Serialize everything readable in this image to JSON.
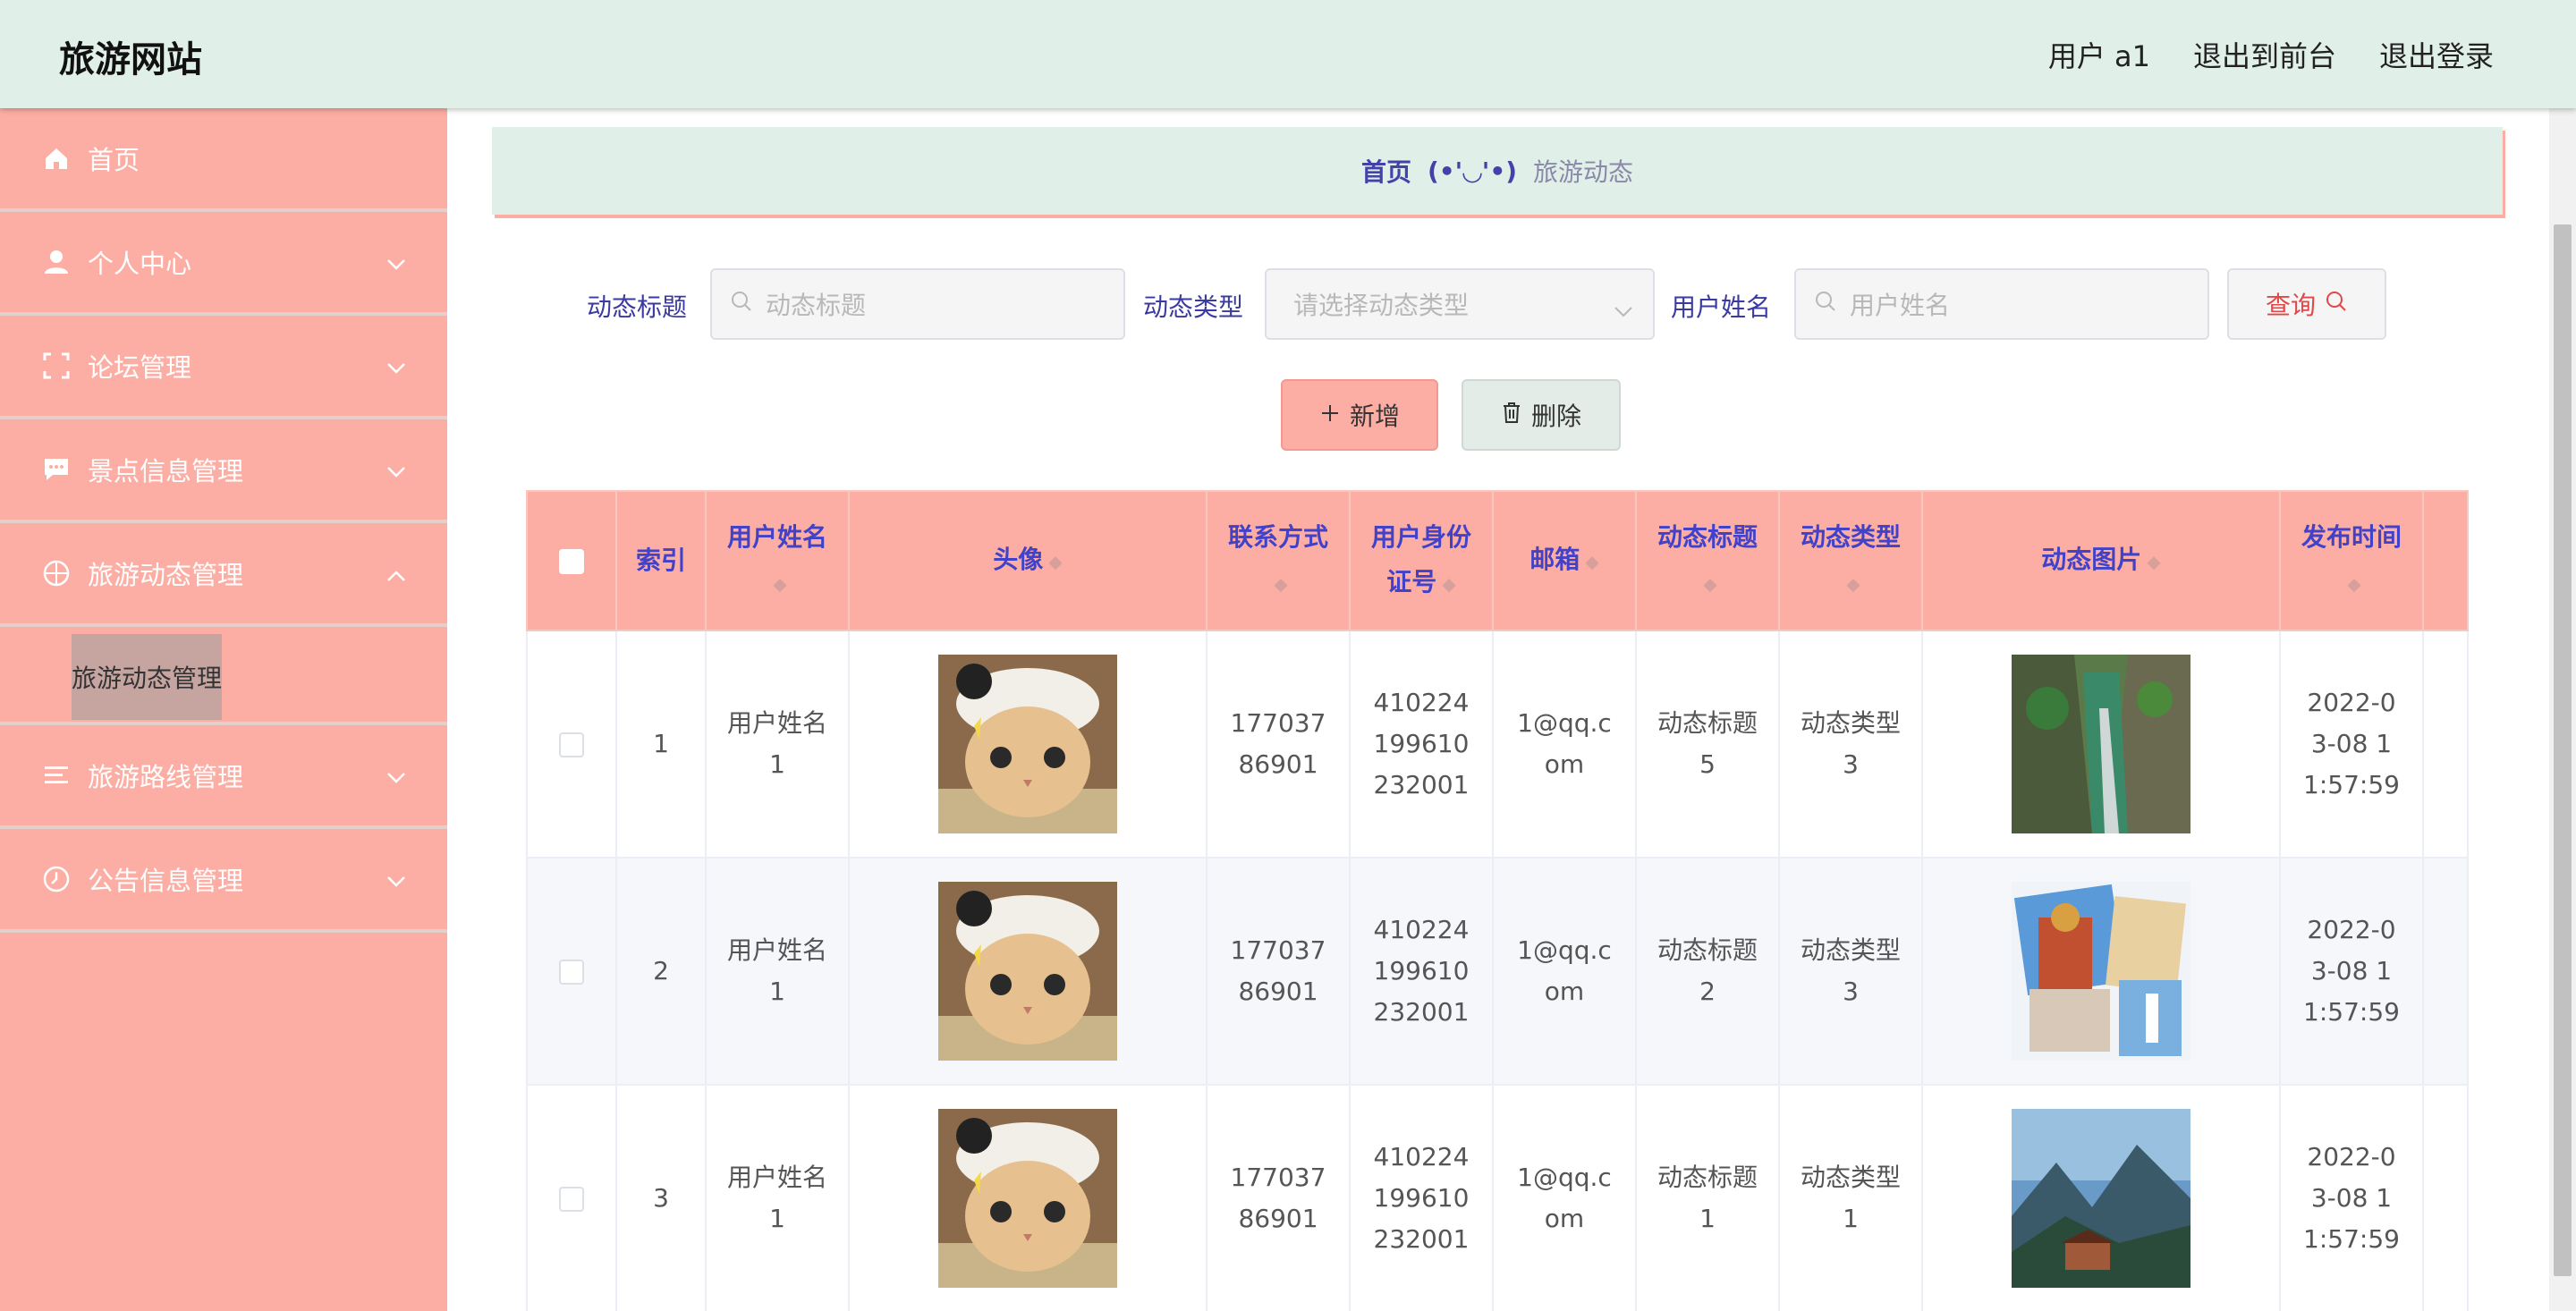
{
  "header": {
    "title": "旅游网站",
    "user": "用户 a1",
    "exit_front": "退出到前台",
    "logout": "退出登录"
  },
  "sidebar": {
    "items": [
      {
        "label": "首页",
        "icon": "home-icon"
      },
      {
        "label": "个人中心",
        "icon": "user-icon"
      },
      {
        "label": "论坛管理",
        "icon": "frame-icon"
      },
      {
        "label": "景点信息管理",
        "icon": "message-icon"
      },
      {
        "label": "旅游动态管理",
        "icon": "compass-icon"
      },
      {
        "label": "旅游路线管理",
        "icon": "list-icon"
      },
      {
        "label": "公告信息管理",
        "icon": "clock-icon"
      }
    ],
    "active_sub": "旅游动态管理"
  },
  "breadcrumb": {
    "home": "首页",
    "emoji": "(•'◡'•)",
    "current": "旅游动态"
  },
  "search": {
    "title_label": "动态标题",
    "title_placeholder": "动态标题",
    "type_label": "动态类型",
    "type_placeholder": "请选择动态类型",
    "name_label": "用户姓名",
    "name_placeholder": "用户姓名",
    "query_button": "查询"
  },
  "actions": {
    "add": "新增",
    "delete": "删除"
  },
  "table": {
    "headers": {
      "index": "索引",
      "username": "用户姓名",
      "avatar": "头像",
      "contact": "联系方式",
      "idcard": "用户身份证号",
      "email": "邮箱",
      "post_title": "动态标题",
      "post_type": "动态类型",
      "post_image": "动态图片",
      "publish_time": "发布时间"
    },
    "rows": [
      {
        "index": "1",
        "username": "用户姓名1",
        "contact": "17703786901",
        "idcard": "410224199610232001",
        "email": "1@qq.com",
        "post_title": "动态标题5",
        "post_type": "动态类型3",
        "publish_time": "2022-03-08 11:57:59",
        "image_kind": "canyon"
      },
      {
        "index": "2",
        "username": "用户姓名1",
        "contact": "17703786901",
        "idcard": "410224199610232001",
        "email": "1@qq.com",
        "post_title": "动态标题2",
        "post_type": "动态类型3",
        "publish_time": "2022-03-08 11:57:59",
        "image_kind": "collage"
      },
      {
        "index": "3",
        "username": "用户姓名1",
        "contact": "17703786901",
        "idcard": "410224199610232001",
        "email": "1@qq.com",
        "post_title": "动态标题1",
        "post_type": "动态类型1",
        "publish_time": "2022-03-08 11:57:59",
        "image_kind": "mountain"
      }
    ]
  },
  "colors": {
    "header_bg": "#e0efe8",
    "sidebar_bg": "#fdaea4",
    "accent_text": "#4242c8",
    "query_text": "#e04848"
  }
}
